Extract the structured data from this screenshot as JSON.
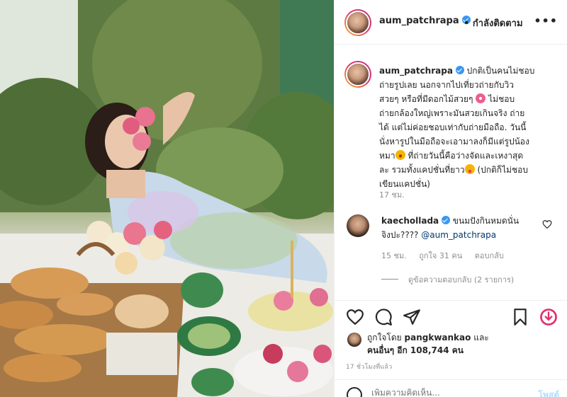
{
  "post": {
    "username": "aum_patchrapa",
    "follow_status": "• กำลังติดตาม",
    "more_icon": "more-dots-icon",
    "caption_lines": [
      "ปกติเป็นคนไม่ชอบ",
      "ถ่ายรูปเลย นอกจากไปเที่ยวถ่ายกับวิว",
      "สวยๆ หรือที่มีดอกไม้สวยๆ",
      " ไม่ชอบ",
      "ถ่ายกล้องใหญ่เพราะมันสวยเกินจริง ถ่าย",
      "ได้ แต่ไม่ค่อยชอบเท่ากับถ่ายมือถือ. วันนี้",
      "นั่งหารูปในมือถือจะเอามาลงก็มีแต่รูปน้อง",
      "หมา",
      " ที่ถ่ายวันนี้คือว่างจัดและเหงาสุด",
      "ละ รวมทั้งแคปชั่นที่ยาว",
      " (ปกติก็ไม่ชอบ",
      "เขียนแคปชั่น)"
    ],
    "caption_time": "17 ชม.",
    "likes_prefix": "ถูกใจโดย",
    "liked_by_user": "pangkwankao",
    "likes_and": "และ",
    "likes_others": "คนอื่นๆ อีก 108,744 คน",
    "post_time": "17 ชั่วโมงที่แล้ว",
    "add_comment_placeholder": "เพิ่มความคิดเห็น...",
    "post_button": "โพสต์"
  },
  "reply": {
    "username": "kaechollada",
    "text_line1": "ขนมปังกินหมดนั่น",
    "text_line2": "จิงปะ????",
    "mention": "@aum_patchrapa",
    "time": "15 ชม.",
    "likes": "ถูกใจ 31 คน",
    "reply_button": "ตอบกลับ",
    "view_replies": "ดูข้อความตอบกลับ (2 รายการ)"
  },
  "icons": {
    "like": "heart-icon",
    "comment": "comment-icon",
    "share": "share-icon",
    "save": "bookmark-icon",
    "emoji": "smile-icon"
  },
  "colors": {
    "verified": "#3897f0",
    "secondary_text": "#8e8e8e",
    "divider": "#efefef"
  }
}
